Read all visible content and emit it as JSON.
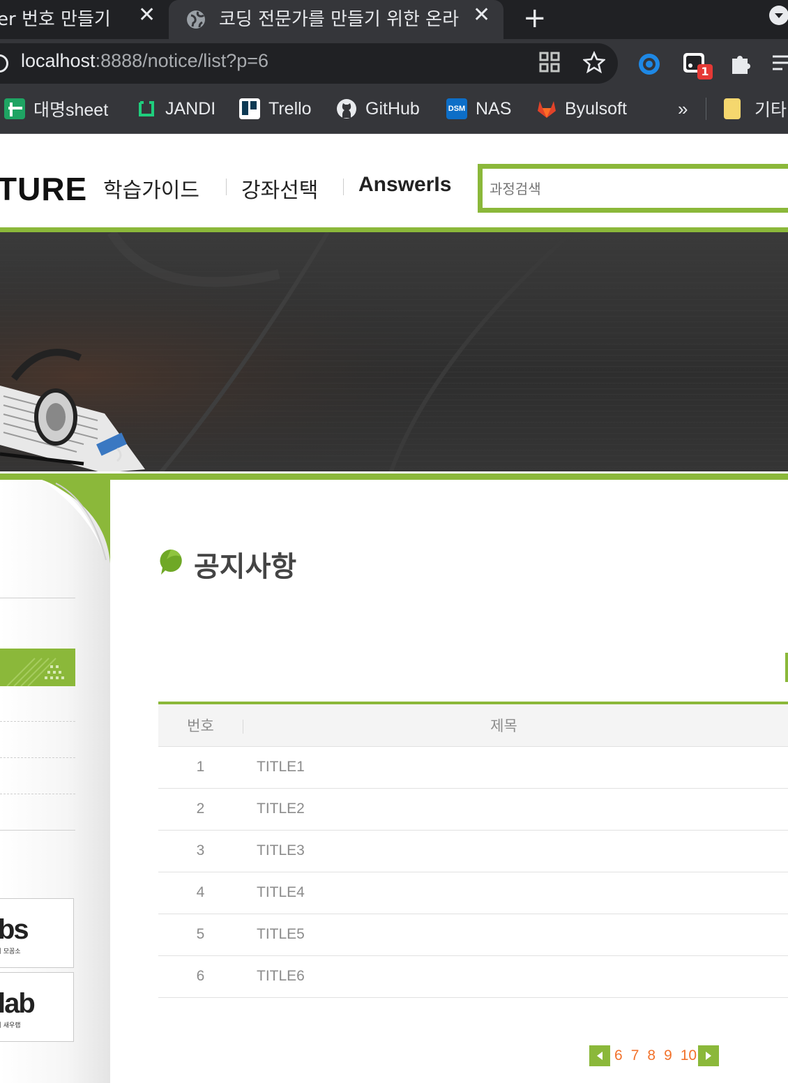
{
  "browser": {
    "tabs": [
      {
        "title": "er 번호 만들기",
        "close": "✕"
      },
      {
        "title": "코딩 전문가를 만들기 위한 온라",
        "close": "✕"
      }
    ],
    "new_tab": "+",
    "url_host": "localhost",
    "url_rest": ":8888/notice/list?p=6",
    "bookmarks": [
      {
        "label": "대명sheet",
        "icon": "sheets-icon"
      },
      {
        "label": "JANDI",
        "icon": "jandi-icon"
      },
      {
        "label": "Trello",
        "icon": "trello-icon"
      },
      {
        "label": "GitHub",
        "icon": "github-icon"
      },
      {
        "label": "NAS",
        "icon": "nas-icon"
      },
      {
        "label": "Byulsoft",
        "icon": "gitlab-icon"
      }
    ],
    "more_bookmarks": "»",
    "other_bookmarks": "기타",
    "extension_badge": "1"
  },
  "site": {
    "logo": "TURE",
    "nav": [
      "학습가이드",
      "강좌선택",
      "AnswerIs"
    ],
    "search_placeholder": "과정검색",
    "banner_ad_1": "bs",
    "banner_ad_1_sub": "뉴렉처 모꼼소",
    "banner_ad_2": "lab",
    "banner_ad_2_sub": "뉴렉처 새우랩"
  },
  "main": {
    "title": "공지사항",
    "table": {
      "headers": [
        "번호",
        "제목"
      ],
      "rows": [
        {
          "num": "1",
          "title": "TITLE1"
        },
        {
          "num": "2",
          "title": "TITLE2"
        },
        {
          "num": "3",
          "title": "TITLE3"
        },
        {
          "num": "4",
          "title": "TITLE4"
        },
        {
          "num": "5",
          "title": "TITLE5"
        },
        {
          "num": "6",
          "title": "TITLE6"
        }
      ]
    },
    "pager": [
      "6",
      "7",
      "8",
      "9",
      "10"
    ]
  },
  "colors": {
    "accent": "#8bb83a",
    "pager_number": "#f2722b",
    "chrome_dark": "#202124",
    "chrome_mid": "#35363a"
  }
}
